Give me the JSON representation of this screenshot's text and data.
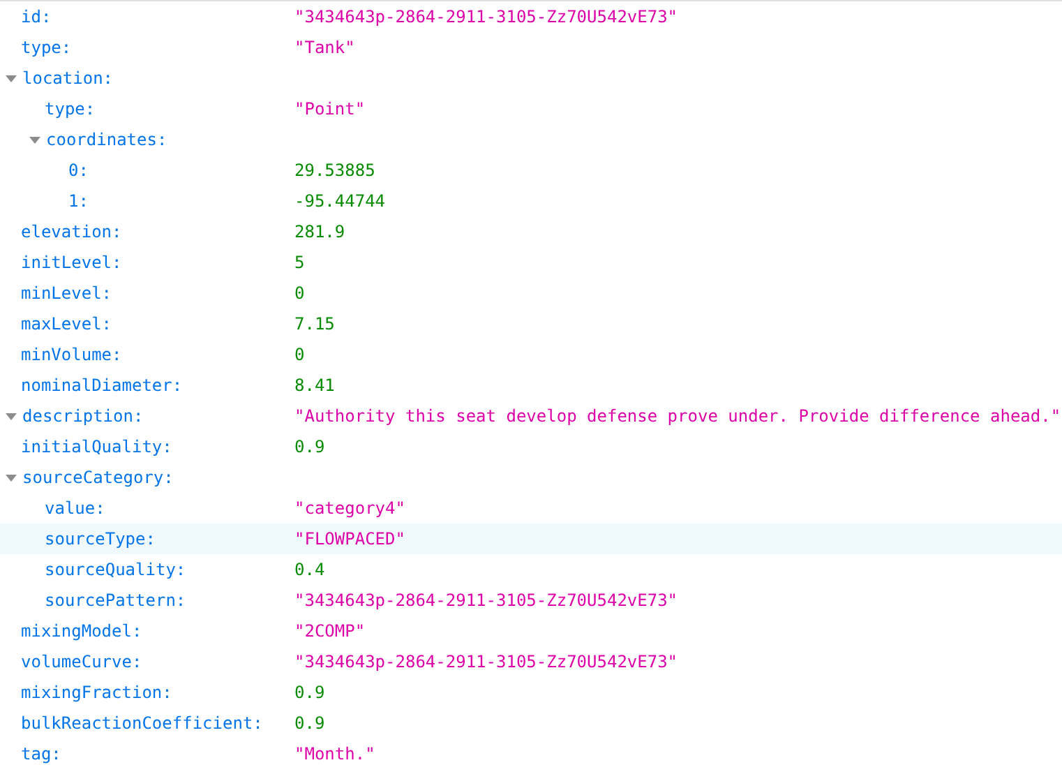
{
  "rows": [
    {
      "key": "id:",
      "kind": "string",
      "value": "\"3434643p-2864-2911-3105-Zz70U542vE73\"",
      "selected": false
    },
    {
      "key": "type:",
      "kind": "string",
      "value": "\"Tank\"",
      "selected": false
    },
    {
      "key": "location:",
      "expanded": true,
      "selected": false,
      "children": [
        {
          "key": "type:",
          "kind": "string",
          "value": "\"Point\"",
          "selected": false
        },
        {
          "key": "coordinates:",
          "expanded": true,
          "selected": false,
          "children": [
            {
              "key": "0:",
              "kind": "number",
              "value": "29.53885",
              "selected": false
            },
            {
              "key": "1:",
              "kind": "number",
              "value": "-95.44744",
              "selected": false
            }
          ]
        }
      ]
    },
    {
      "key": "elevation:",
      "kind": "number",
      "value": "281.9",
      "selected": false
    },
    {
      "key": "initLevel:",
      "kind": "number",
      "value": "5",
      "selected": false
    },
    {
      "key": "minLevel:",
      "kind": "number",
      "value": "0",
      "selected": false
    },
    {
      "key": "maxLevel:",
      "kind": "number",
      "value": "7.15",
      "selected": false
    },
    {
      "key": "minVolume:",
      "kind": "number",
      "value": "0",
      "selected": false
    },
    {
      "key": "nominalDiameter:",
      "kind": "number",
      "value": "8.41",
      "selected": false
    },
    {
      "key": "description:",
      "kind": "string",
      "expanded": true,
      "value": "\"Authority this seat develop defense prove under. Provide difference ahead.\"",
      "selected": false
    },
    {
      "key": "initialQuality:",
      "kind": "number",
      "value": "0.9",
      "selected": false
    },
    {
      "key": "sourceCategory:",
      "expanded": true,
      "selected": false,
      "children": [
        {
          "key": "value:",
          "kind": "string",
          "value": "\"category4\"",
          "selected": false
        },
        {
          "key": "sourceType:",
          "kind": "string",
          "value": "\"FLOWPACED\"",
          "selected": true
        },
        {
          "key": "sourceQuality:",
          "kind": "number",
          "value": "0.4",
          "selected": false
        },
        {
          "key": "sourcePattern:",
          "kind": "string",
          "value": "\"3434643p-2864-2911-3105-Zz70U542vE73\"",
          "selected": false
        }
      ]
    },
    {
      "key": "mixingModel:",
      "kind": "string",
      "value": "\"2COMP\"",
      "selected": false
    },
    {
      "key": "volumeCurve:",
      "kind": "string",
      "value": "\"3434643p-2864-2911-3105-Zz70U542vE73\"",
      "selected": false
    },
    {
      "key": "mixingFraction:",
      "kind": "number",
      "value": "0.9",
      "selected": false
    },
    {
      "key": "bulkReactionCoefficient:",
      "kind": "number",
      "value": "0.9",
      "selected": false
    },
    {
      "key": "tag:",
      "kind": "string",
      "value": "\"Month.\"",
      "selected": false
    }
  ]
}
